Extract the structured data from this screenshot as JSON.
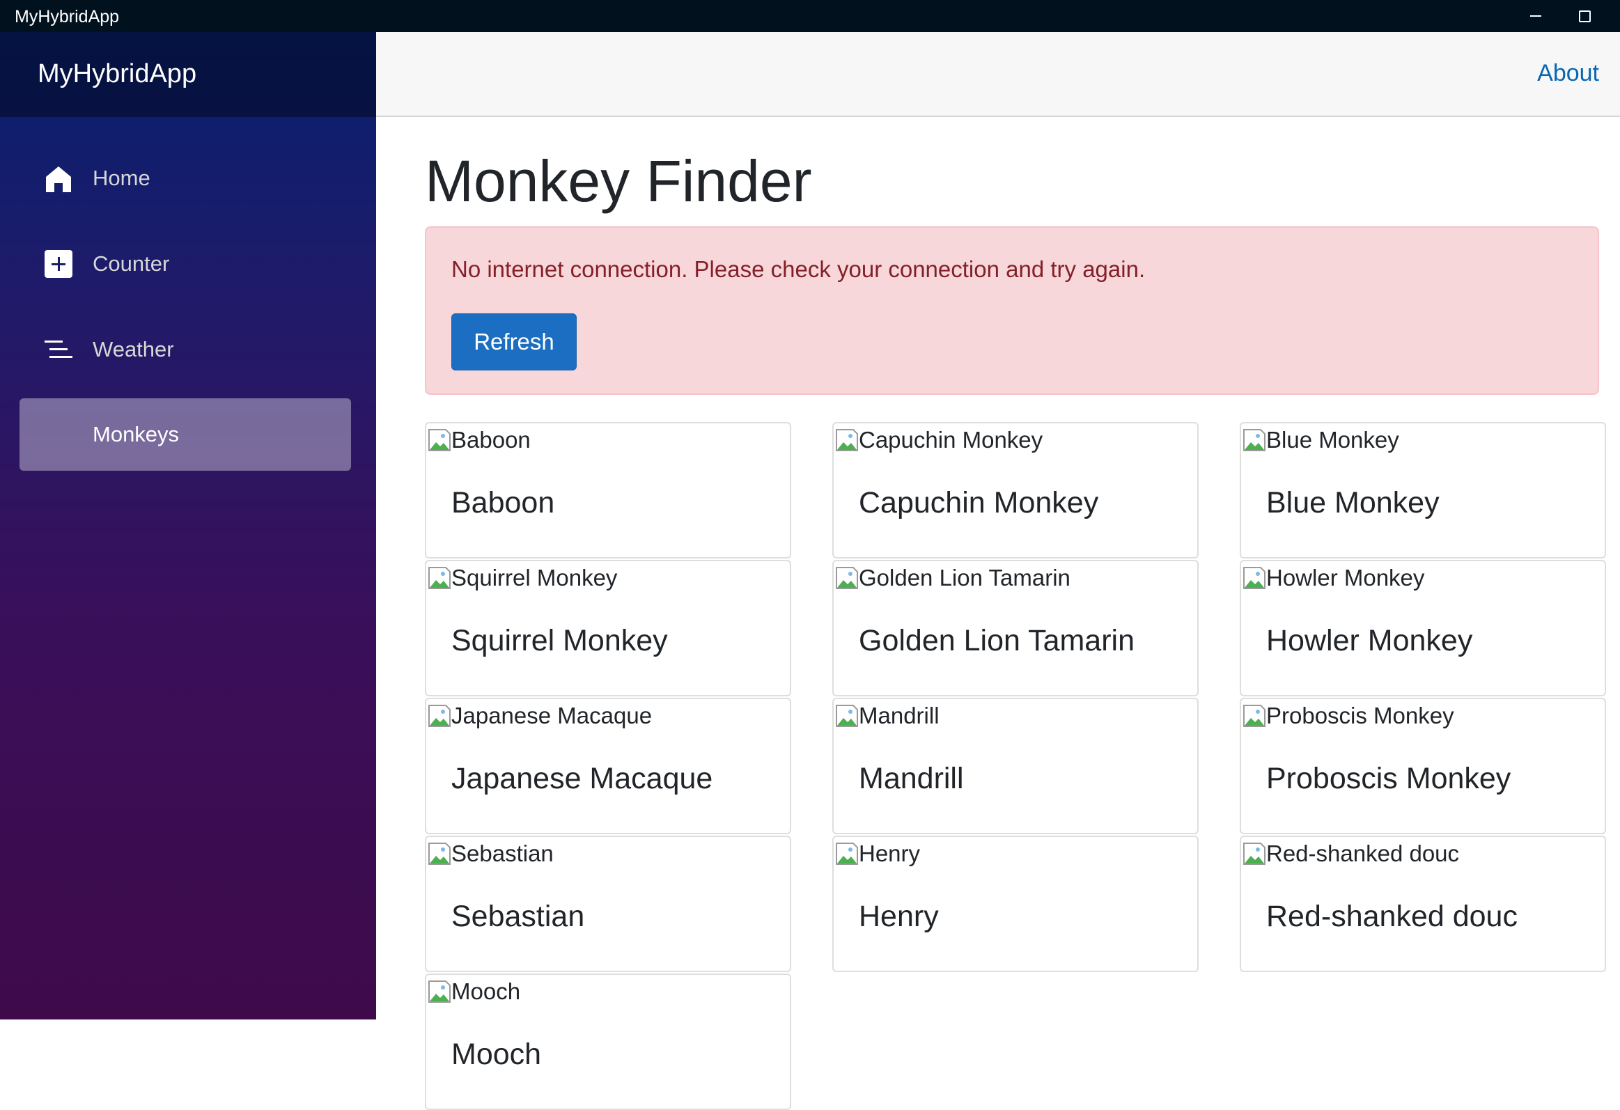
{
  "window": {
    "title": "MyHybridApp",
    "controls": [
      "minimize-icon",
      "maximize-icon"
    ]
  },
  "sidebar": {
    "brand": "MyHybridApp",
    "items": [
      {
        "label": "Home",
        "icon": "home-icon",
        "active": false
      },
      {
        "label": "Counter",
        "icon": "plus-square-icon",
        "active": false
      },
      {
        "label": "Weather",
        "icon": "list-lines-icon",
        "active": false
      },
      {
        "label": "Monkeys",
        "icon": "",
        "active": true
      }
    ]
  },
  "topbar": {
    "about_label": "About"
  },
  "main": {
    "title": "Monkey Finder",
    "alert": {
      "message": "No internet connection. Please check your connection and try again.",
      "button_label": "Refresh"
    },
    "monkeys": [
      {
        "alt": "Baboon",
        "name": "Baboon"
      },
      {
        "alt": "Capuchin Monkey",
        "name": "Capuchin Monkey"
      },
      {
        "alt": "Blue Monkey",
        "name": "Blue Monkey"
      },
      {
        "alt": "Squirrel Monkey",
        "name": "Squirrel Monkey"
      },
      {
        "alt": "Golden Lion Tamarin",
        "name": "Golden Lion Tamarin"
      },
      {
        "alt": "Howler Monkey",
        "name": "Howler Monkey"
      },
      {
        "alt": "Japanese Macaque",
        "name": "Japanese Macaque"
      },
      {
        "alt": "Mandrill",
        "name": "Mandrill"
      },
      {
        "alt": "Proboscis Monkey",
        "name": "Proboscis Monkey"
      },
      {
        "alt": "Sebastian",
        "name": "Sebastian"
      },
      {
        "alt": "Henry",
        "name": "Henry"
      },
      {
        "alt": "Red-shanked douc",
        "name": "Red-shanked douc"
      },
      {
        "alt": "Mooch",
        "name": "Mooch"
      }
    ]
  },
  "colors": {
    "sidebar_top": "#06206f",
    "sidebar_bottom": "#3e0a4a",
    "alert_bg": "#f8d7da",
    "alert_text": "#842029",
    "button_bg": "#1b6ec2",
    "link": "#0a66b3"
  }
}
